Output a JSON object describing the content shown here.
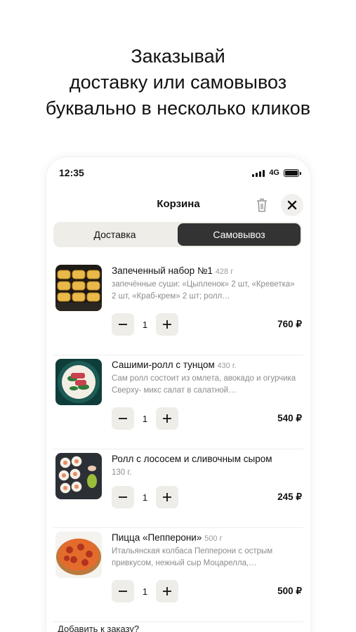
{
  "headline": {
    "line1": "Заказывай",
    "line2": "доставку или самовывоз",
    "line3": "буквально в несколько кликов"
  },
  "status_bar": {
    "time": "12:35",
    "network": "4G"
  },
  "cart": {
    "title": "Корзина",
    "icons": {
      "trash": "trash-icon",
      "close": "close-icon"
    },
    "tabs": [
      {
        "label": "Доставка",
        "active": false
      },
      {
        "label": "Самовывоз",
        "active": true
      }
    ],
    "items": [
      {
        "name": "Запеченный набор №1",
        "weight": "428 г",
        "desc": "запечённые суши: «Цыпленок» 2 шт, «Креветка» 2 шт, «Краб-крем» 2 шт; ролл…",
        "qty": "1",
        "price": "760 ₽"
      },
      {
        "name": "Сашими-ролл с тунцом",
        "weight": "430 г.",
        "desc": "Сам ролл состоит из омлета, авокадо и огурчика Сверху- микс салат в салатной…",
        "qty": "1",
        "price": "540 ₽"
      },
      {
        "name": "Ролл с лососем и сливочным сыром",
        "weight": "130 г.",
        "desc": "",
        "qty": "1",
        "price": "245 ₽"
      },
      {
        "name": "Пицца «Пепперони»",
        "weight": "500 г",
        "desc": "Итальянская колбаса Пепперони с острым привкусом, нежный сыр Моцарелла,…",
        "qty": "1",
        "price": "500 ₽"
      }
    ],
    "add_to_order_label": "Добавить к заказу?"
  }
}
